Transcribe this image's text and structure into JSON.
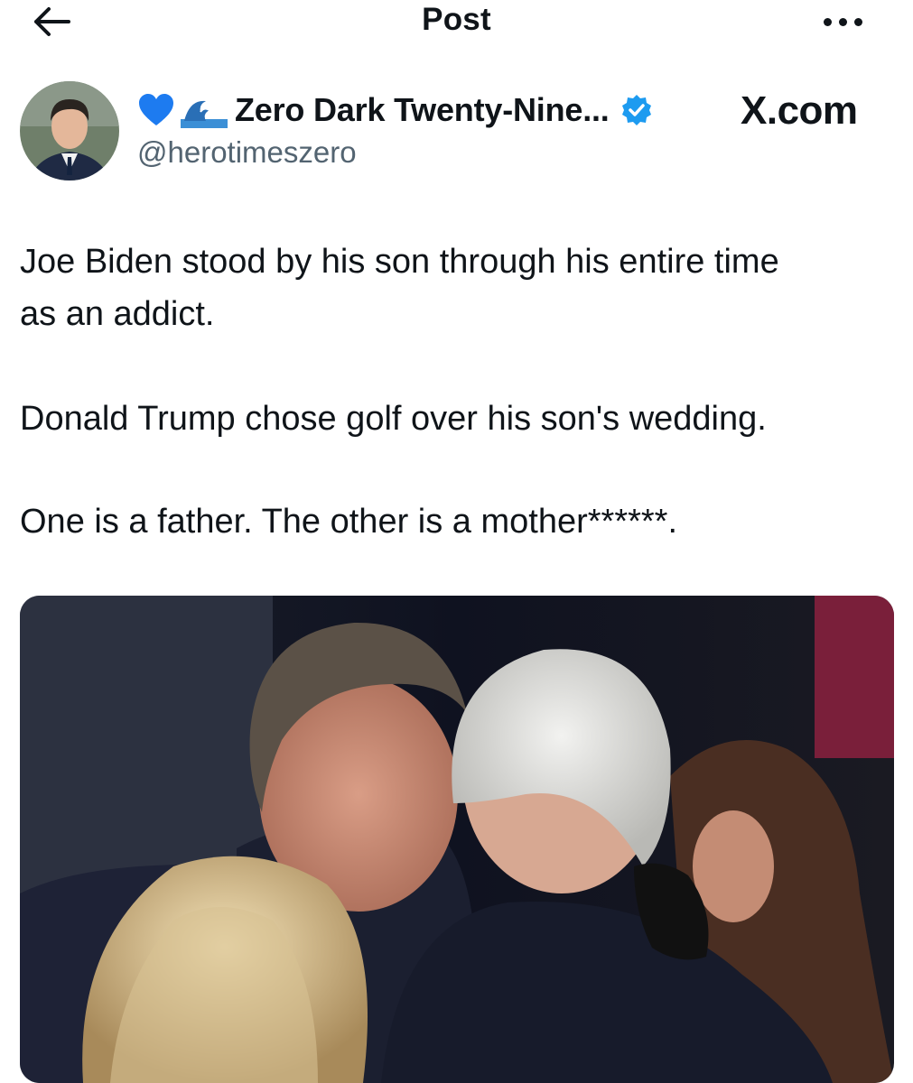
{
  "header": {
    "title": "Post"
  },
  "author": {
    "display_name": "Zero Dark Twenty-Nine...",
    "handle": "@herotimeszero",
    "name_emojis": [
      "blue-heart",
      "wave"
    ],
    "verified": true
  },
  "watermark": "X.com",
  "tweet": {
    "paragraphs": [
      "Joe Biden stood by his son through his entire time",
      "as an addict.",
      "Donald Trump chose golf over his son's wedding.",
      "One is a father. The other is a mother******."
    ]
  },
  "colors": {
    "text": "#0f1419",
    "secondary": "#536471",
    "verified": "#1d9bf0",
    "heart": "#1d7bf0"
  }
}
